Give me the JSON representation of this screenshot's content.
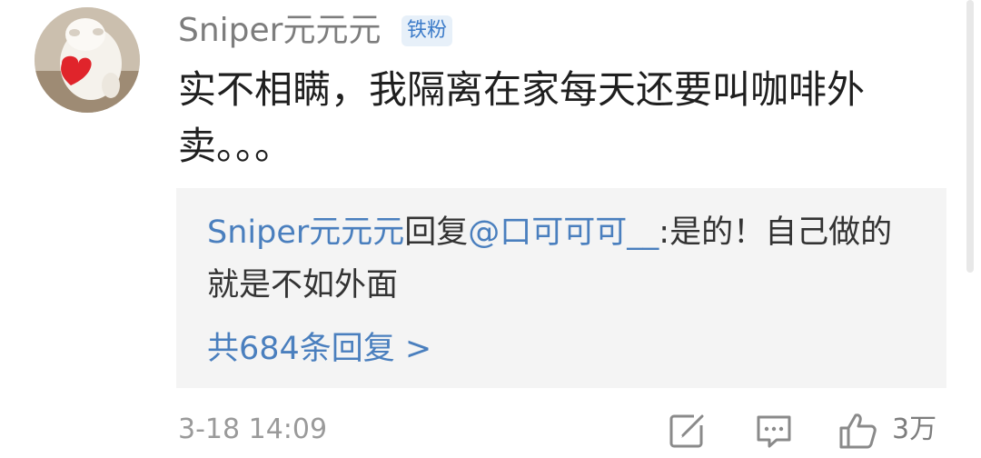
{
  "comment": {
    "username": "Sniper元元元",
    "badge": "铁粉",
    "text": "实不相瞒，我隔离在家每天还要叫咖啡外卖。。。",
    "timestamp": "3-18 14:09",
    "like_count": "3万"
  },
  "reply": {
    "user": "Sniper元元元",
    "verb": "回复",
    "mention": "@口可可可__",
    "text": ":是的！自己做的就是不如外面",
    "more_label": "共684条回复 >"
  },
  "icons": {
    "avatar": "sheep-plush-with-red-heart-avatar",
    "repost": "edit-share-icon",
    "comment": "comment-bubble-icon",
    "like": "thumbs-up-icon"
  },
  "colors": {
    "username": "#7d7d7d",
    "link": "#4a7fbe",
    "badge_bg": "#e7f0f9",
    "badge_text": "#3d7cc9",
    "reply_bg": "#f4f4f4"
  }
}
